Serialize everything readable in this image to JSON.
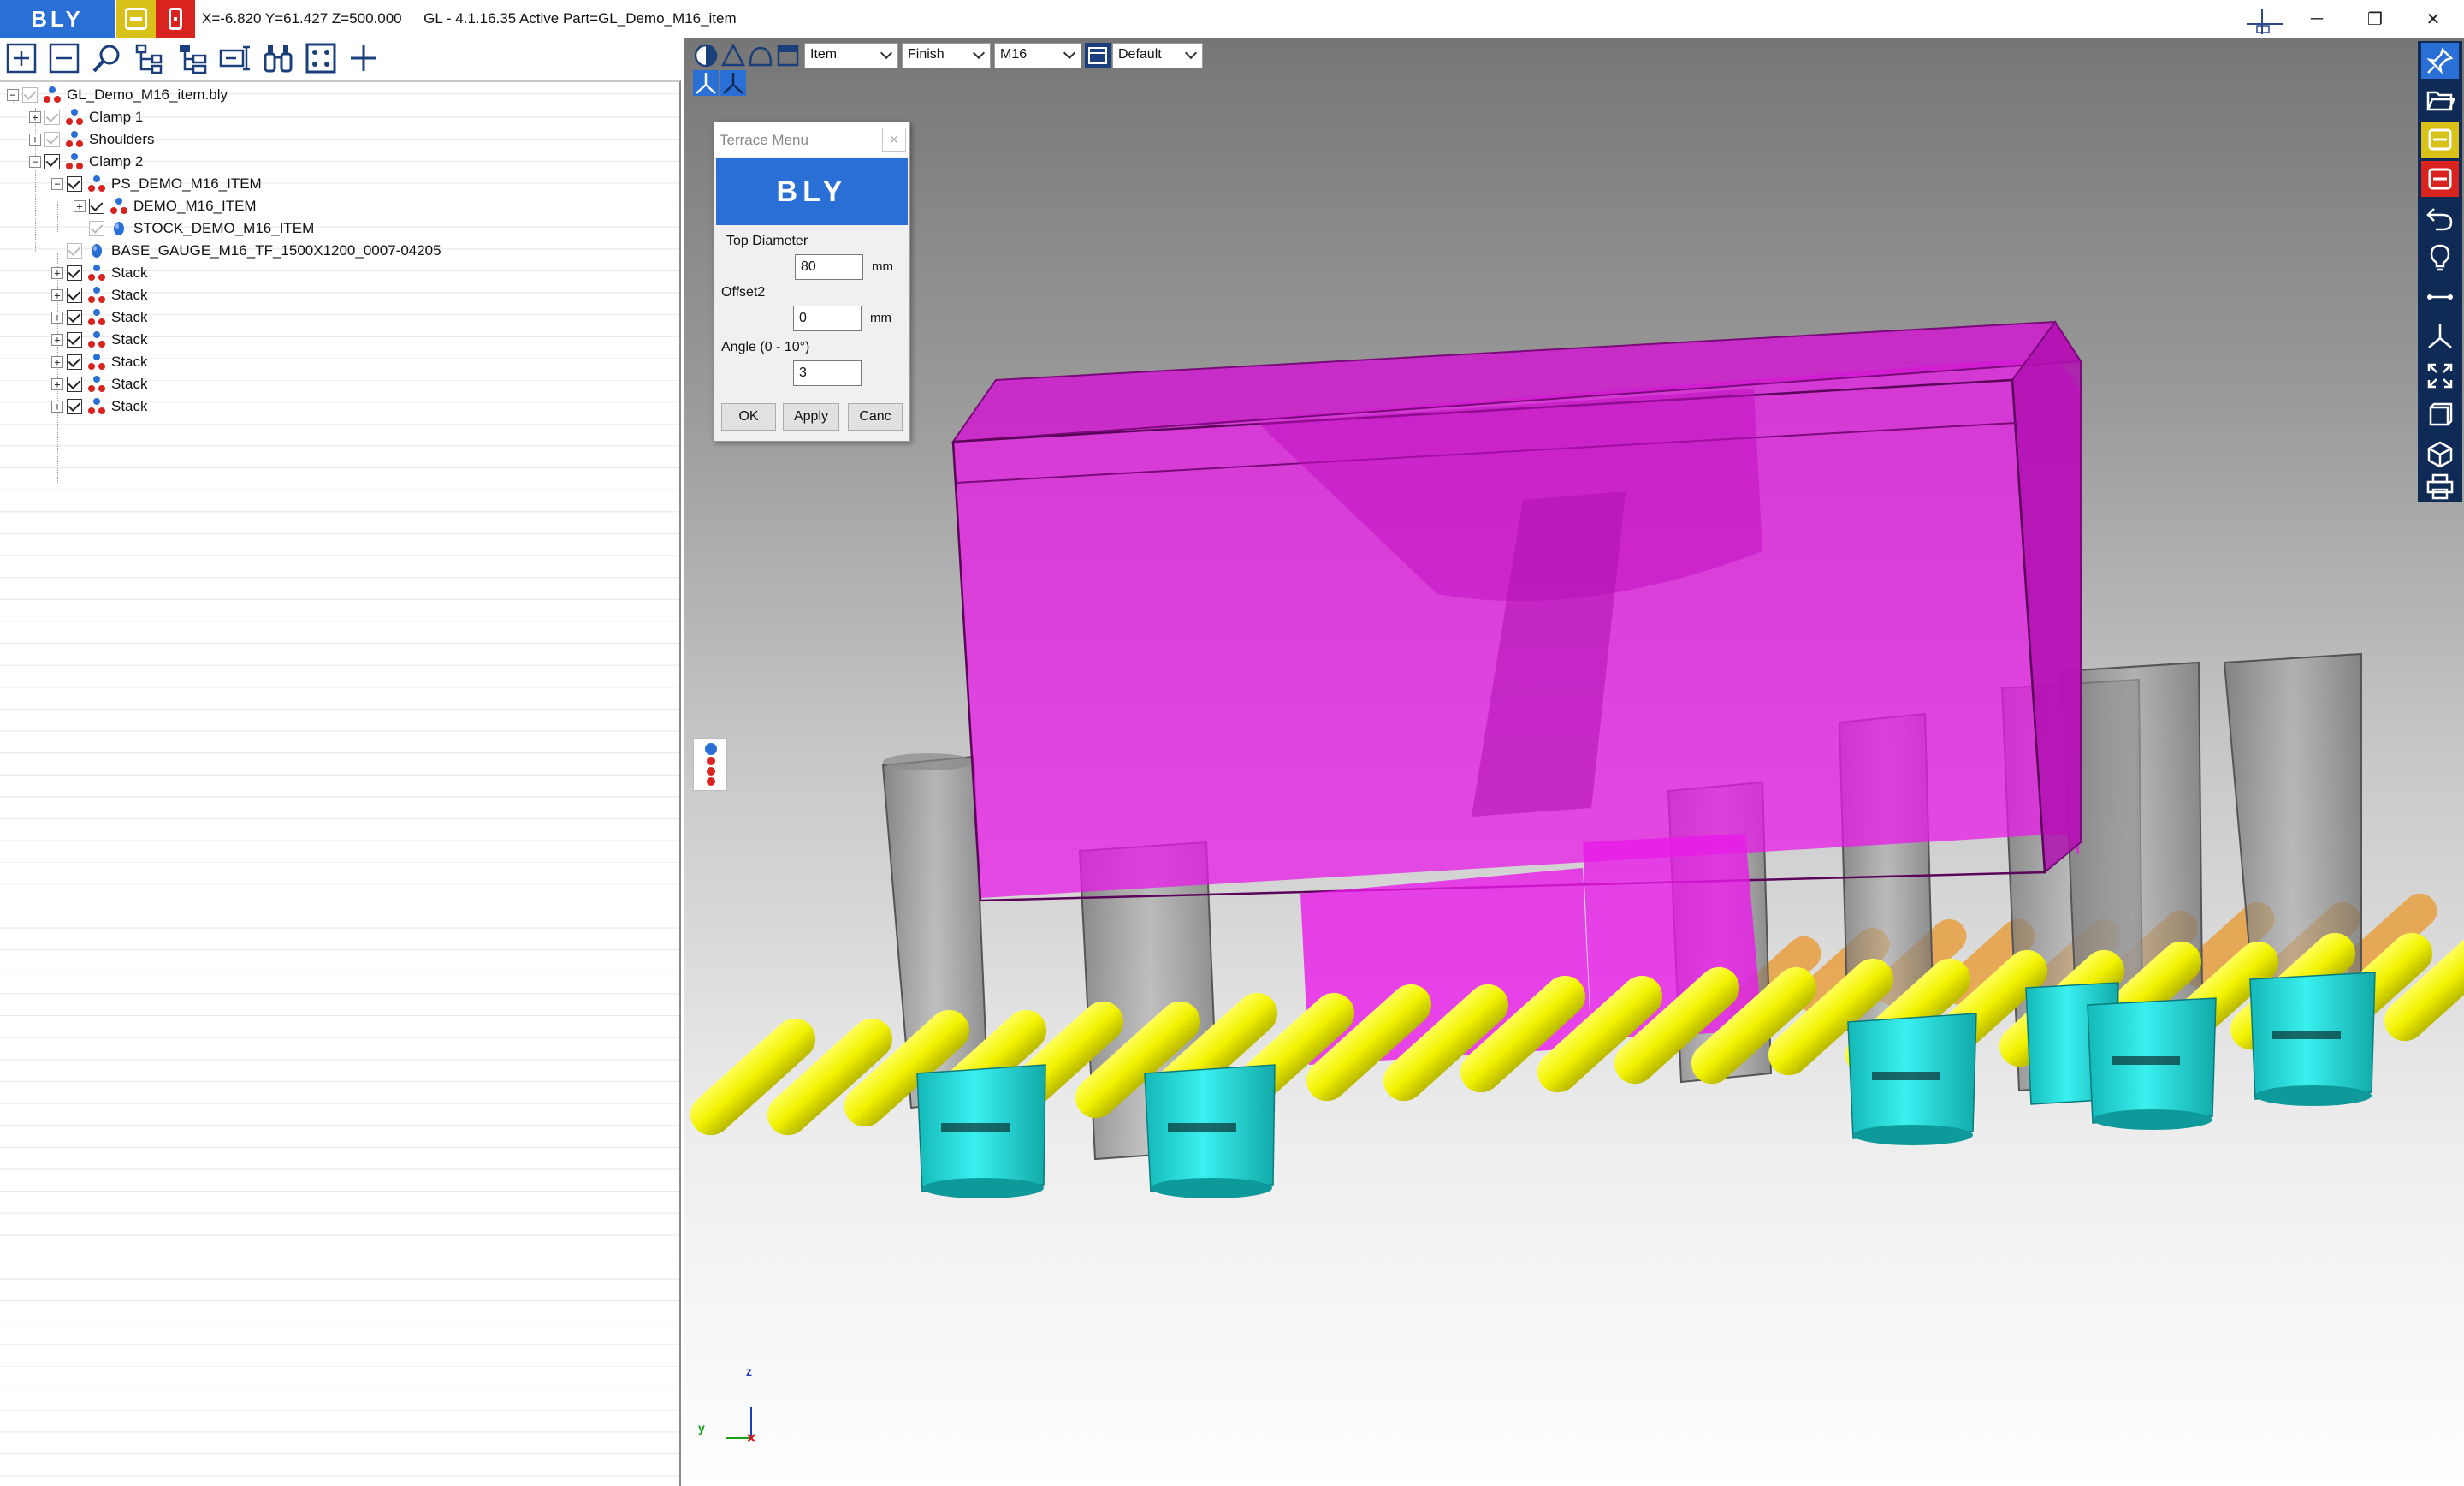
{
  "titlebar": {
    "logo": "BLY",
    "coords": "X=-6.820 Y=61.427 Z=500.000",
    "title": "GL - 4.1.16.35 Active Part=GL_Demo_M16_item",
    "win_min": "─",
    "win_restore": "❐",
    "win_close": "✕"
  },
  "tree": {
    "items": [
      {
        "label": "GL_Demo_M16_item.bly"
      },
      {
        "label": "Clamp 1"
      },
      {
        "label": "Shoulders"
      },
      {
        "label": "Clamp 2"
      },
      {
        "label": "PS_DEMO_M16_ITEM"
      },
      {
        "label": "DEMO_M16_ITEM"
      },
      {
        "label": "STOCK_DEMO_M16_ITEM"
      },
      {
        "label": "BASE_GAUGE_M16_TF_1500X1200_0007-04205"
      },
      {
        "label": "Stack"
      },
      {
        "label": "Stack"
      },
      {
        "label": "Stack"
      },
      {
        "label": "Stack"
      },
      {
        "label": "Stack"
      },
      {
        "label": "Stack"
      },
      {
        "label": "Stack"
      }
    ],
    "expander_plus": "+",
    "expander_minus": "−"
  },
  "viewport_toolbar": {
    "select_item": "Item",
    "select_finish": "Finish",
    "select_m16": "M16",
    "select_default": "Default"
  },
  "dialog": {
    "title": "Terrace Menu",
    "close": "×",
    "banner": "BLY",
    "top_diameter_label": "Top Diameter",
    "top_diameter_value": "80",
    "top_diameter_unit": "mm",
    "offset2_label": "Offset2",
    "offset2_value": "0",
    "offset2_unit": "mm",
    "angle_label": "Angle (0 - 10°)",
    "angle_value": "3",
    "ok": "OK",
    "apply": "Apply",
    "cancel": "Canc"
  },
  "axis": {
    "z": "z",
    "y": "y"
  },
  "colors": {
    "brand_blue": "#2a6fd6",
    "yellow_btn": "#d8c21a",
    "red_btn": "#d8231f",
    "part_magenta": "#e81ae8",
    "pin_yellow": "#f2f200",
    "base_cyan": "#22d3d3",
    "right_toolbar": "#0e2a55"
  }
}
